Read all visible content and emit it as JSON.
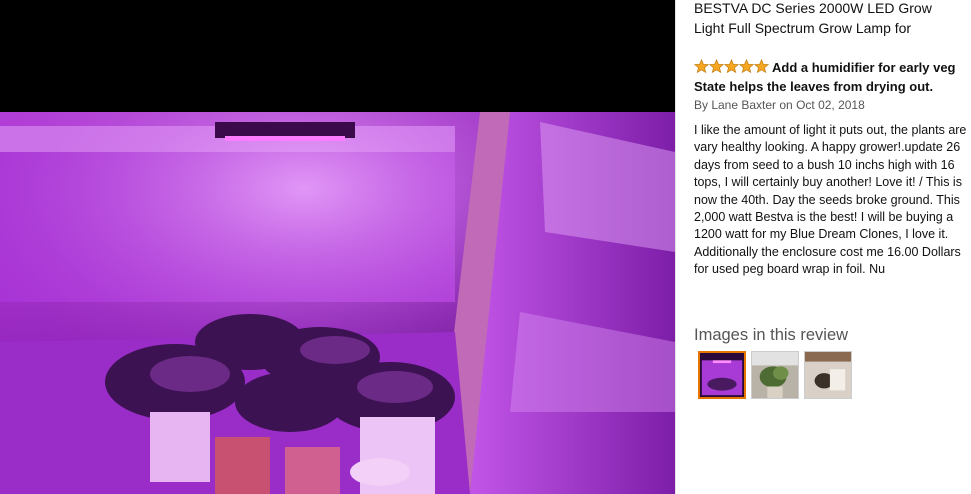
{
  "product": {
    "title": "BESTVA DC Series 2000W LED Grow Light Full Spectrum Grow Lamp for"
  },
  "review": {
    "rating": 5,
    "rating_max": 5,
    "headline": "Add a humidifier for early veg State helps the leaves from drying out.",
    "byline": "By Lane Baxter on Oct 02, 2018",
    "body": "I like the amount of light it puts out, the plants are vary healthy looking. A happy grower!.update 26 days from seed to a bush 10 inchs high with 16 tops, I will certainly buy another! Love it! / This is now the 40th. Day the seeds broke ground. This 2,000 watt Bestva is the best! I will be buying a 1200 watt for my Blue Dream Clones, I love it. Additionally the enclosure cost me 16.00 Dollars for used peg board wrap in foil. Nu"
  },
  "images_section": {
    "heading": "Images in this review",
    "selected_index": 0,
    "thumbnails": [
      {
        "icon": "grow-tent-photo"
      },
      {
        "icon": "plant-photo"
      },
      {
        "icon": "humidifier-photo"
      }
    ]
  },
  "colors": {
    "star": "#f5a623",
    "selected_border": "#e77600",
    "text": "#111111",
    "muted": "#555555"
  }
}
